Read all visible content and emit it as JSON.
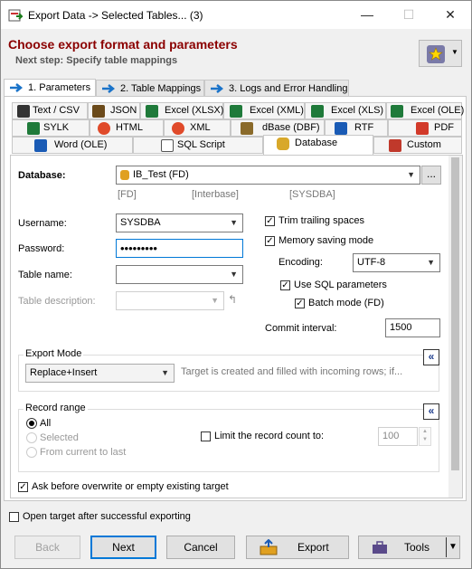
{
  "window": {
    "title": "Export Data -> Selected Tables... (3)",
    "minimize_glyph": "—",
    "maximize_glyph": "☐",
    "close_glyph": "✕"
  },
  "header": {
    "title": "Choose export format and parameters",
    "subtitle": "Next step: Specify table mappings",
    "favorites_icon": "star-icon"
  },
  "wizard_tabs": [
    {
      "label": "1. Parameters",
      "active": true
    },
    {
      "label": "2. Table Mappings",
      "active": false
    },
    {
      "label": "3. Logs and Error Handling",
      "active": false
    }
  ],
  "format_tabs": {
    "row1": [
      "Text / CSV",
      "JSON",
      "Excel (XLSX)",
      "Excel (XML)",
      "Excel (XLS)",
      "Excel (OLE)"
    ],
    "row2": [
      "SYLK",
      "HTML",
      "XML",
      "dBase (DBF)",
      "RTF",
      "PDF"
    ],
    "row3": [
      "Word (OLE)",
      "SQL Script",
      "Database",
      "Custom"
    ],
    "active": "Database"
  },
  "form": {
    "database_label": "Database:",
    "database_value": "IB_Test (FD)",
    "database_browse": "...",
    "db_tags": [
      "[FD]",
      "[Interbase]",
      "[SYSDBA]"
    ],
    "username_label": "Username:",
    "username_value": "SYSDBA",
    "password_label": "Password:",
    "password_value": "•••••••••",
    "table_name_label": "Table name:",
    "table_name_value": "",
    "table_desc_label": "Table description:",
    "trim_label": "Trim trailing spaces",
    "trim_checked": true,
    "memory_label": "Memory saving mode",
    "memory_checked": true,
    "encoding_label": "Encoding:",
    "encoding_value": "UTF-8",
    "sql_params_label": "Use SQL parameters",
    "sql_params_checked": true,
    "batch_label": "Batch mode (FD)",
    "batch_checked": true,
    "commit_label": "Commit interval:",
    "commit_value": "1500"
  },
  "export_mode": {
    "legend": "Export Mode",
    "value": "Replace+Insert",
    "hint": "Target is created and filled with incoming rows; if..."
  },
  "record_range": {
    "legend": "Record range",
    "options": [
      "All",
      "Selected",
      "From current to last"
    ],
    "selected": "All",
    "limit_label": "Limit the record count to:",
    "limit_checked": false,
    "limit_value": "100"
  },
  "ask_overwrite": {
    "label": "Ask before overwrite or empty existing target",
    "checked": true
  },
  "open_target": {
    "label": "Open target after successful exporting",
    "checked": false
  },
  "buttons": {
    "back": "Back",
    "next": "Next",
    "cancel": "Cancel",
    "export": "Export",
    "tools": "Tools"
  },
  "colors": {
    "header_title": "#8b0000",
    "accent_blue": "#1d3c8c",
    "focus_border": "#0078d7"
  }
}
